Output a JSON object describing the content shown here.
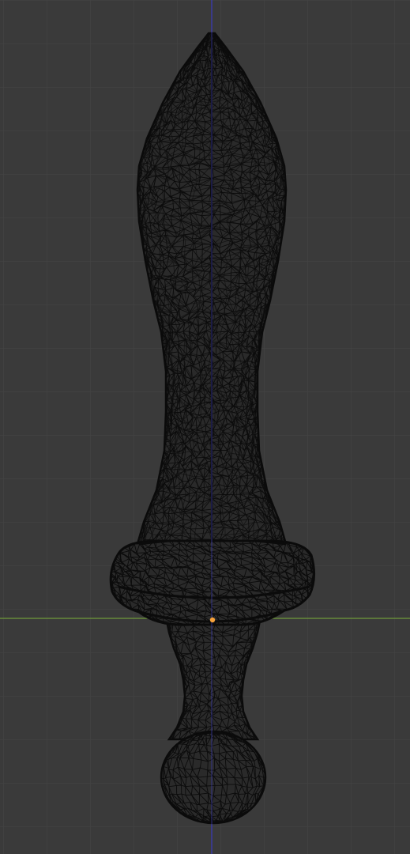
{
  "viewport": {
    "background_color": "#3a3a3a",
    "grid_color": "#454545",
    "x_axis_color": "#6f9a3a",
    "z_axis_color": "#3b3bb4",
    "mesh_fill_color": "#2a2a2a",
    "wire_color": "#0b0b0b",
    "origin_color": "#f5a13b",
    "object": {
      "semantic_name": "sword-mesh-wireframe",
      "display_mode": "wireframe"
    }
  }
}
